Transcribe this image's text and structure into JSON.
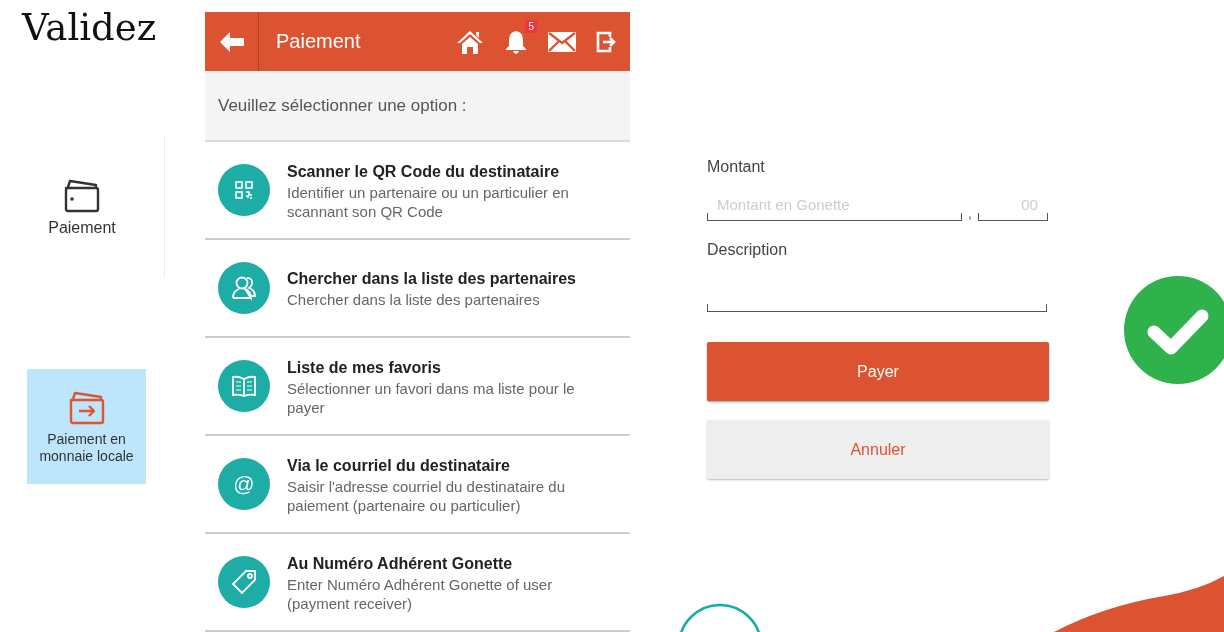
{
  "title": "Validez",
  "menu_tiles": [
    {
      "kind": "wallet",
      "label": "Paiement",
      "selected": false
    },
    {
      "kind": "transfer",
      "label": "Paiement en monnaie locale",
      "selected": true
    }
  ],
  "app": {
    "header": {
      "title": "Paiement",
      "notification_count": "5"
    },
    "prompt": "Veuillez sélectionner une option :",
    "options": [
      {
        "kind": "qr",
        "title": "Scanner le QR Code du destinataire",
        "description": "Identifier un partenaire ou un particulier en scannant son QR Code"
      },
      {
        "kind": "partners",
        "title": "Chercher dans la liste des partenaires",
        "description": "Chercher dans la liste des partenaires"
      },
      {
        "kind": "favorites",
        "title": "Liste de mes favoris",
        "description": "Sélectionner un favori dans ma liste pour le payer"
      },
      {
        "kind": "email",
        "glyph": "@",
        "title": "Via le courriel du destinataire",
        "description": "Saisir l'adresse courriel du destinataire du paiement (partenaire ou particulier)"
      },
      {
        "kind": "tag",
        "title": "Au Numéro Adhérent Gonette",
        "description": "Enter Numéro Adhérent Gonette of user (payment receiver)"
      }
    ]
  },
  "form": {
    "amount": {
      "label": "Montant",
      "placeholder": "Montant en Gonette",
      "separator": ",",
      "cents_placeholder": "00"
    },
    "description": {
      "label": "Description"
    },
    "buttons": [
      {
        "kind": "primary",
        "label": "Payer"
      },
      {
        "kind": "secondary",
        "label": "Annuler"
      }
    ]
  }
}
